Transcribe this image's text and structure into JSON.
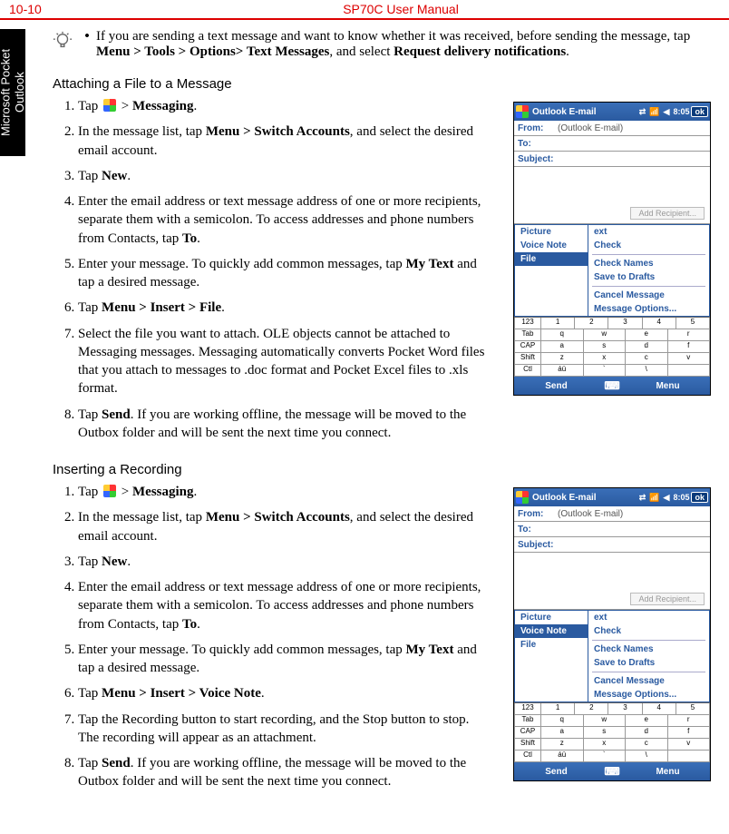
{
  "header": {
    "page_number": "10-10",
    "title": "SP70C User Manual"
  },
  "side_tab": "Microsoft Pocket Outlook",
  "tip": {
    "bullet": "•",
    "text_parts": [
      "If you are sending a text message and want to know whether it was received, before sending the message, tap ",
      "Menu > Tools > Options> Text Messages",
      ", and select ",
      "Request delivery notifications",
      "."
    ]
  },
  "section1": {
    "title": "Attaching a File to a Message",
    "steps": [
      {
        "pre": "Tap ",
        "icon": true,
        "mid1": " > ",
        "b1": "Messaging",
        "post1": "."
      },
      {
        "pre": "In the message list, tap ",
        "b1": "Menu > Switch Accounts",
        "post1": ", and select the desired email account."
      },
      {
        "pre": "Tap ",
        "b1": "New",
        "post1": "."
      },
      {
        "pre": "Enter the email address or text message address of one or more recipients, separate them with a semicolon. To access addresses and phone numbers from Contacts, tap ",
        "b1": "To",
        "post1": "."
      },
      {
        "pre": "Enter your message. To quickly add common messages, tap ",
        "b1": "My Text",
        "post1": " and tap a desired message."
      },
      {
        "pre": "Tap ",
        "b1": "Menu > Insert > File",
        "post1": "."
      },
      {
        "pre": "Select the file you want to attach. OLE objects cannot be attached to Messaging messages. Messaging automatically converts Pocket Word files that you attach to messages to .doc format and Pocket Excel files to .xls format."
      },
      {
        "pre": "Tap ",
        "b1": "Send",
        "post1": ". If you are working offline, the message will be moved to the Outbox folder and will be sent the next time you connect."
      }
    ],
    "figure": {
      "titlebar_app": "Outlook E-mail",
      "titlebar_time": "8:05",
      "from_label": "From:",
      "from_value": "(Outlook E-mail)",
      "to_label": "To:",
      "subject_label": "Subject:",
      "add_recipient": "Add Recipient...",
      "insert_menu": [
        "Picture",
        "Voice Note",
        "File"
      ],
      "menu_right": [
        "ext",
        "Check",
        "Check Names",
        "Save to Drafts",
        "Cancel Message",
        "Message Options..."
      ],
      "sip_rows": [
        {
          "label": "123",
          "keys": [
            "1",
            "2",
            "3",
            "4",
            "5"
          ]
        },
        {
          "label": "Tab",
          "keys": [
            "q",
            "w",
            "e",
            "r"
          ]
        },
        {
          "label": "CAP",
          "keys": [
            "a",
            "s",
            "d",
            "f"
          ]
        },
        {
          "label": "Shift",
          "keys": [
            "z",
            "x",
            "c",
            "v"
          ]
        },
        {
          "label": "Ctl",
          "keys": [
            "áü",
            "`",
            "\\",
            ""
          ]
        }
      ],
      "soft_left": "Send",
      "soft_right": "Menu",
      "ok": "ok",
      "selected_insert": "File"
    }
  },
  "section2": {
    "title": "Inserting a Recording",
    "steps": [
      {
        "pre": "Tap ",
        "icon": true,
        "mid1": " > ",
        "b1": "Messaging",
        "post1": "."
      },
      {
        "pre": "In the message list, tap ",
        "b1": "Menu > Switch Accounts",
        "post1": ", and select the desired email account."
      },
      {
        "pre": "Tap ",
        "b1": "New",
        "post1": "."
      },
      {
        "pre": "Enter the email address or text message address of one or more recipients, separate them with a semicolon. To access addresses and phone numbers from Contacts, tap ",
        "b1": "To",
        "post1": "."
      },
      {
        "pre": "Enter your message. To quickly add common messages, tap ",
        "b1": "My Text",
        "post1": " and tap a desired message."
      },
      {
        "pre": "Tap ",
        "b1": "Menu > Insert > Voice Note",
        "post1": "."
      },
      {
        "pre": "Tap the Recording button to start recording, and the Stop button to stop. The recording will appear as an attachment."
      },
      {
        "pre": "Tap ",
        "b1": "Send",
        "post1": ". If you are working offline, the message will be moved to the Outbox folder and will be sent the next time you connect."
      }
    ],
    "figure": {
      "titlebar_app": "Outlook E-mail",
      "titlebar_time": "8:05",
      "from_label": "From:",
      "from_value": "(Outlook E-mail)",
      "to_label": "To:",
      "subject_label": "Subject:",
      "add_recipient": "Add Recipient...",
      "insert_menu": [
        "Picture",
        "Voice Note",
        "File"
      ],
      "menu_right": [
        "ext",
        "Check",
        "Check Names",
        "Save to Drafts",
        "Cancel Message",
        "Message Options..."
      ],
      "sip_rows": [
        {
          "label": "123",
          "keys": [
            "1",
            "2",
            "3",
            "4",
            "5"
          ]
        },
        {
          "label": "Tab",
          "keys": [
            "q",
            "w",
            "e",
            "r"
          ]
        },
        {
          "label": "CAP",
          "keys": [
            "a",
            "s",
            "d",
            "f"
          ]
        },
        {
          "label": "Shift",
          "keys": [
            "z",
            "x",
            "c",
            "v"
          ]
        },
        {
          "label": "Ctl",
          "keys": [
            "áü",
            "`",
            "\\",
            ""
          ]
        }
      ],
      "soft_left": "Send",
      "soft_right": "Menu",
      "ok": "ok",
      "selected_insert": "Voice Note"
    }
  }
}
